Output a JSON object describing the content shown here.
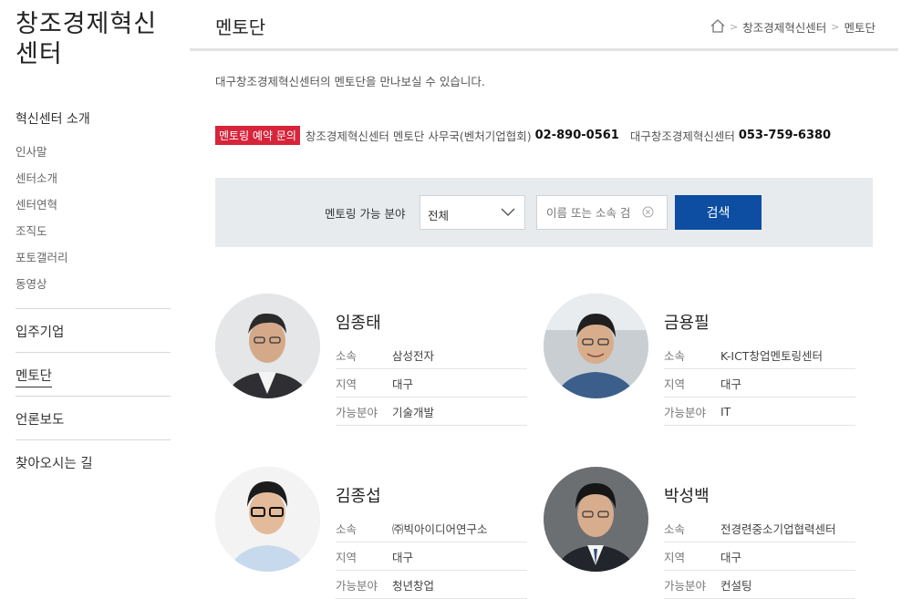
{
  "sidebar": {
    "site_title": "창조경제혁신\n센터",
    "group_title": "혁신센터 소개",
    "sub_items": [
      "인사말",
      "센터소개",
      "센터연혁",
      "조직도",
      "포토갤러리",
      "동영상"
    ],
    "main_items": [
      "입주기업",
      "멘토단",
      "언론보도",
      "찾아오시는 길"
    ]
  },
  "header": {
    "title": "멘토단",
    "breadcrumb": [
      "창조경제혁신센터",
      "멘토단"
    ]
  },
  "intro": "대구창조경제혁신센터의 멘토단을 만나보실 수 있습니다.",
  "contact": {
    "badge": "멘토링 예약 문의",
    "office_label": "창조경제혁신센터 멘토단 사무국(벤처기업협회)",
    "office_phone": "02-890-0561",
    "center_label": "대구창조경제혁신센터",
    "center_phone": "053-759-6380"
  },
  "search": {
    "label": "멘토링 가능 분야",
    "select_value": "전체",
    "input_placeholder": "이름 또는 소속 검",
    "button_label": "검색"
  },
  "field_labels": {
    "org": "소속",
    "region": "지역",
    "field": "가능분야"
  },
  "mentors": [
    {
      "name": "임종태",
      "org": "삼성전자",
      "region": "대구",
      "field": "기술개발"
    },
    {
      "name": "금용필",
      "org": "K-ICT창업멘토링센터",
      "region": "대구",
      "field": "IT"
    },
    {
      "name": "김종섭",
      "org": "㈜빅아이디어연구소",
      "region": "대구",
      "field": "청년창업"
    },
    {
      "name": "박성백",
      "org": "전경련중소기업협력센터",
      "region": "대구",
      "field": "컨설팅"
    }
  ],
  "colors": {
    "accent_blue": "#0d4ea3",
    "badge_red": "#d6243a",
    "panel_bg": "#e8ebee"
  }
}
